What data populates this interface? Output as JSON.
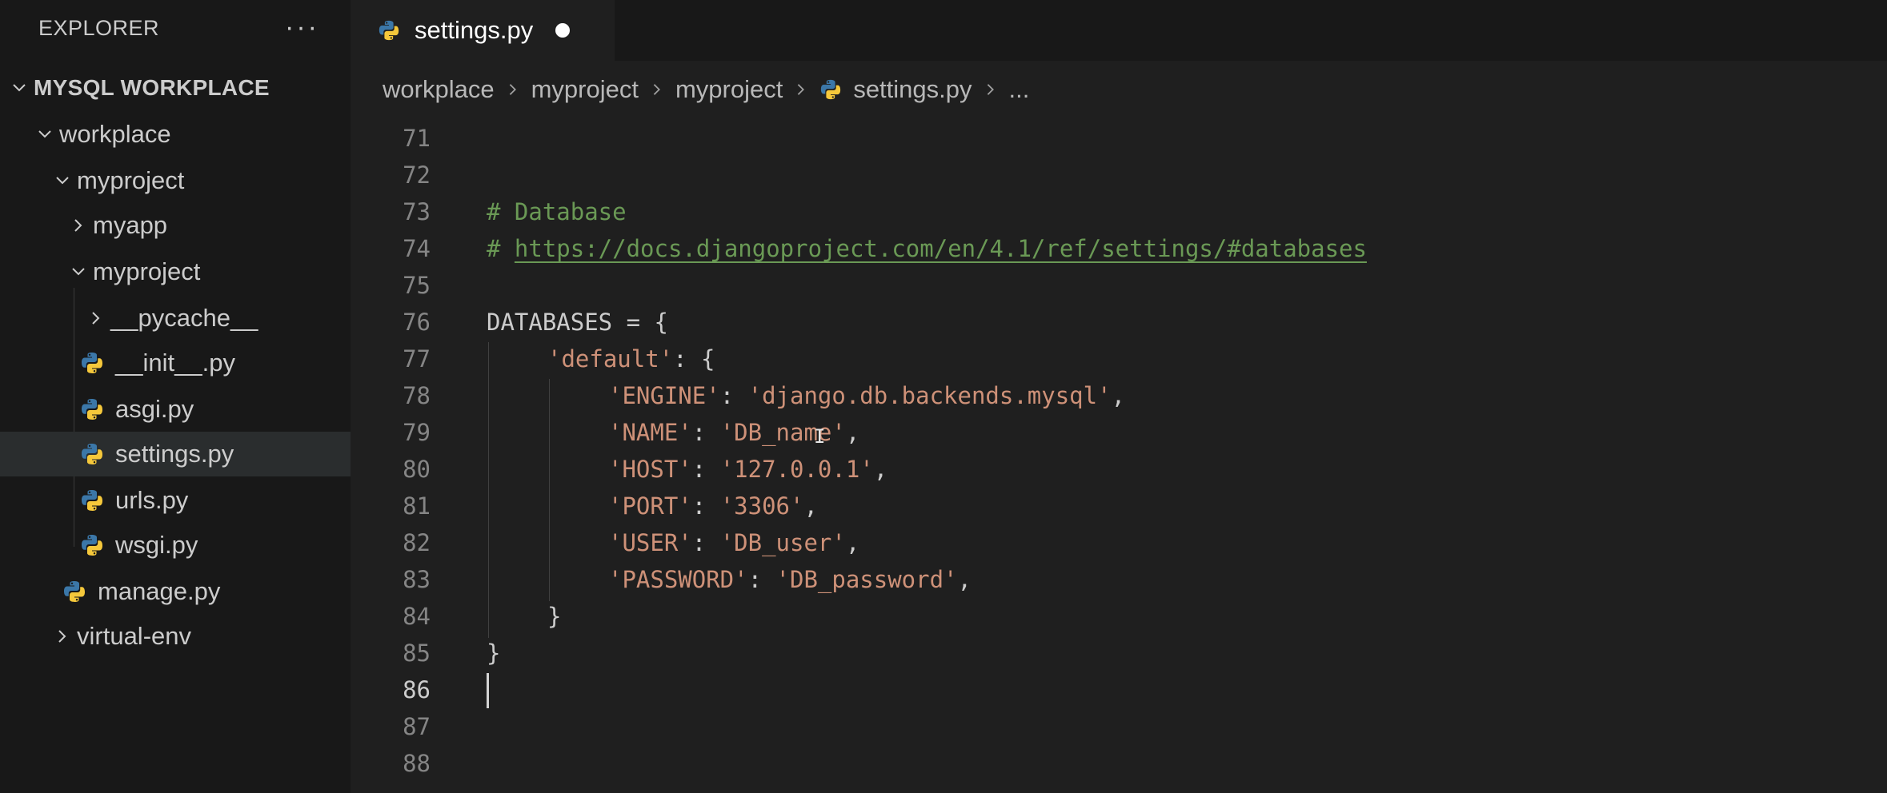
{
  "sidebar": {
    "title": "EXPLORER",
    "more_label": "···",
    "root": "MYSQL WORKPLACE",
    "items": [
      {
        "label": "workplace"
      },
      {
        "label": "myproject"
      },
      {
        "label": "myapp"
      },
      {
        "label": "myproject"
      },
      {
        "label": "__pycache__"
      },
      {
        "label": "__init__.py"
      },
      {
        "label": "asgi.py"
      },
      {
        "label": "settings.py"
      },
      {
        "label": "urls.py"
      },
      {
        "label": "wsgi.py"
      },
      {
        "label": "manage.py"
      },
      {
        "label": "virtual-env"
      }
    ]
  },
  "tab": {
    "label": "settings.py"
  },
  "breadcrumb": {
    "parts": [
      "workplace",
      "myproject",
      "myproject",
      "settings.py",
      "..."
    ]
  },
  "code": {
    "line_numbers": [
      "71",
      "72",
      "73",
      "74",
      "75",
      "76",
      "77",
      "78",
      "79",
      "80",
      "81",
      "82",
      "83",
      "84",
      "85",
      "86",
      "87",
      "88"
    ],
    "l73": "# Database",
    "l74_hash": "# ",
    "l74_url": "https://docs.djangoproject.com/en/4.1/ref/settings/#databases",
    "l76": "DATABASES = {",
    "l77_key": "'default'",
    "l77_rest": ": {",
    "l78_key": "'ENGINE'",
    "l78_val": "'django.db.backends.mysql'",
    "l79_key": "'NAME'",
    "l79_val": "'DB_name'",
    "l80_key": "'HOST'",
    "l80_val": "'127.0.0.1'",
    "l81_key": "'PORT'",
    "l81_val": "'3306'",
    "l82_key": "'USER'",
    "l82_val": "'DB_user'",
    "l83_key": "'PASSWORD'",
    "l83_val": "'DB_password'",
    "colon": ": ",
    "comma": ",",
    "l84": "}",
    "l85": "}"
  },
  "colors": {
    "comment": "#6a9955",
    "string": "#ce9178",
    "text": "#cccccc",
    "line_number": "#858585",
    "python_blue": "#3b77a8",
    "python_yellow": "#f5c83b"
  }
}
